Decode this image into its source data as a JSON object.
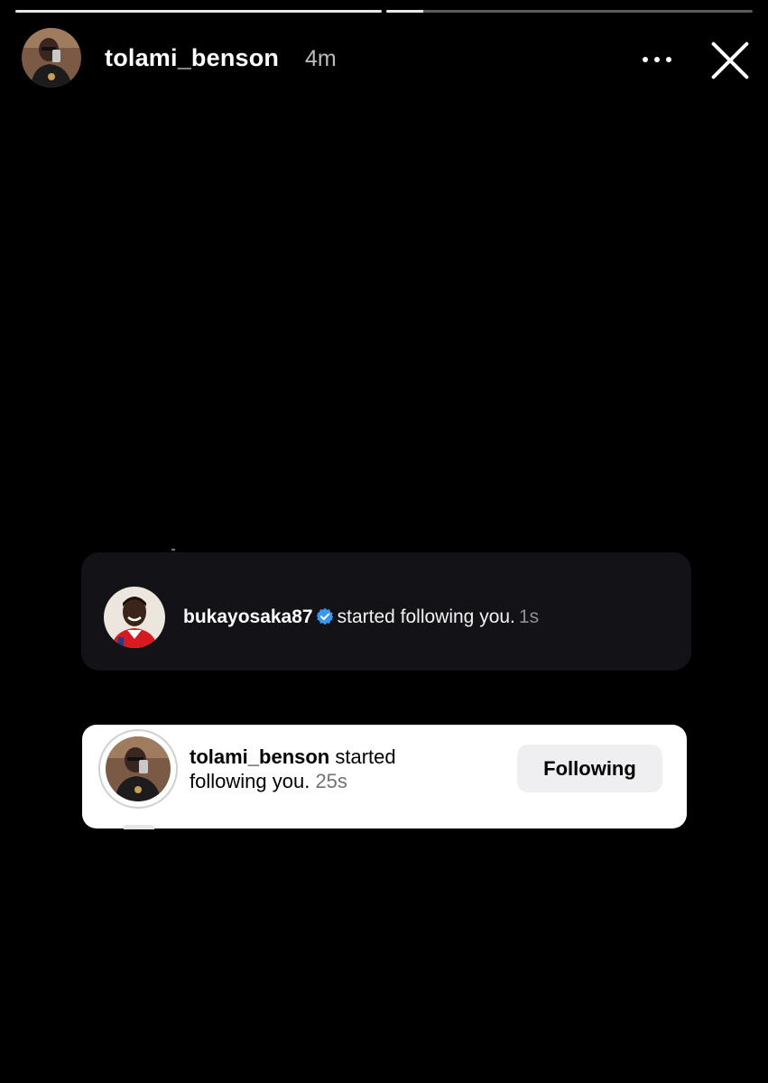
{
  "story": {
    "username": "tolami_benson",
    "time": "4m",
    "progress": [
      1.0,
      0.1
    ]
  },
  "header": {
    "more_icon": "more-horizontal-icon",
    "close_icon": "close-icon"
  },
  "notifications": [
    {
      "username": "bukayosaka87",
      "verified": true,
      "action": "started following you.",
      "timestamp": "1s",
      "theme": "dark"
    },
    {
      "username": "tolami_benson",
      "action": "started following you.",
      "timestamp": "25s",
      "button_label": "Following",
      "theme": "light"
    }
  ],
  "colors": {
    "background": "#000000",
    "verified_badge": "#3897f0",
    "dark_card": "#121217",
    "light_card": "#ffffff",
    "button_bg": "#efeff1"
  }
}
